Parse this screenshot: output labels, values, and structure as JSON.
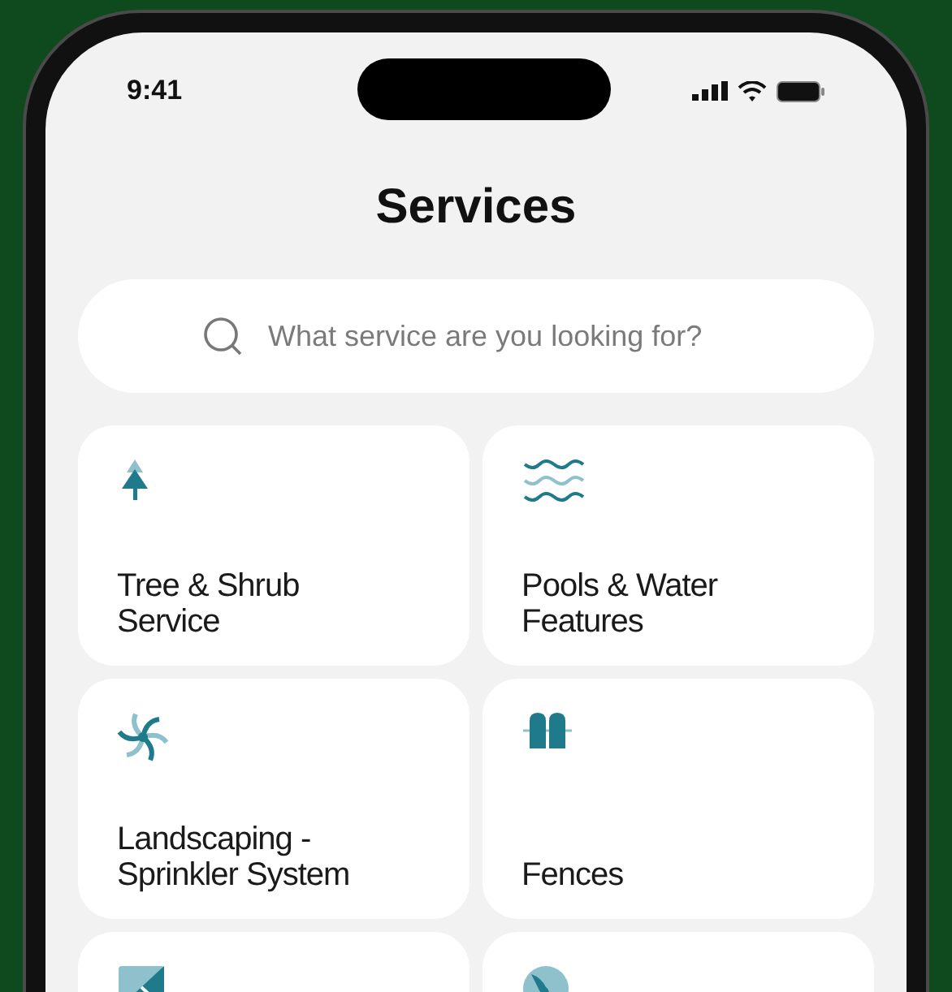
{
  "status_bar": {
    "time": "9:41"
  },
  "title": "Services",
  "search": {
    "placeholder": "What service are you looking for?"
  },
  "services": [
    {
      "kind": "tree",
      "title": "Tree & Shrub Service"
    },
    {
      "kind": "waves",
      "title": "Pools & Water Features"
    },
    {
      "kind": "sprinkler",
      "title": "Landscaping - Sprinkler System"
    },
    {
      "kind": "fence",
      "title": "Fences"
    },
    {
      "kind": "tile"
    },
    {
      "kind": "globe"
    }
  ]
}
